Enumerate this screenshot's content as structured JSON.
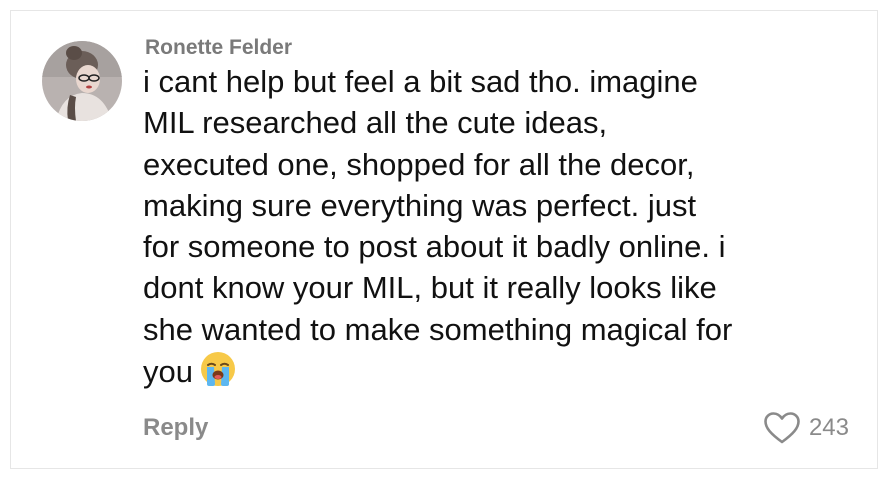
{
  "comment": {
    "author": "Ronette Felder",
    "lines": [
      "i cant help but feel a bit sad tho. imagine",
      "MIL researched all the cute ideas,",
      "executed one, shopped for all the decor,",
      "making sure everything was perfect. just",
      "for someone to post about it badly online. i",
      "dont know your MIL, but it really looks like",
      "she wanted to make something magical for",
      "you"
    ],
    "emoji": "loudly-crying-face-emoji",
    "reply_label": "Reply",
    "like_count": "243",
    "like_icon": "heart-outline-icon"
  },
  "colors": {
    "author": "#7a7a7a",
    "text": "#111111",
    "muted": "#8a8a8a",
    "border": "#e6e6e6"
  }
}
